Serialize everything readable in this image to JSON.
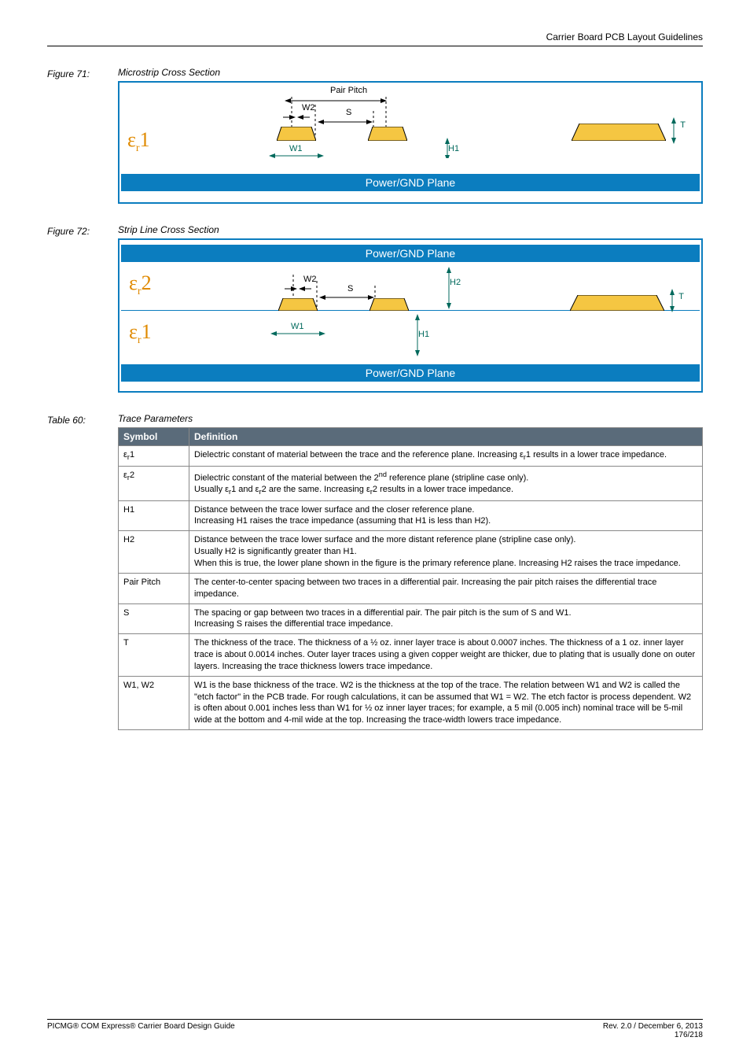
{
  "header": {
    "title": "Carrier Board PCB Layout Guidelines"
  },
  "figure71": {
    "label": "Figure 71:",
    "title": "Microstrip Cross Section",
    "pair_pitch": "Pair Pitch",
    "w2": "W2",
    "s": "S",
    "w1": "W1",
    "t": "T",
    "h1": "H1",
    "eps1": "ε",
    "eps1_sub": "r",
    "eps1_num": "1",
    "plane": "Power/GND Plane"
  },
  "figure72": {
    "label": "Figure 72:",
    "title": "Strip Line Cross Section",
    "plane_top": "Power/GND Plane",
    "plane_bot": "Power/GND Plane",
    "eps2": "ε",
    "eps2_sub": "r",
    "eps2_num": "2",
    "eps1": "ε",
    "eps1_sub": "r",
    "eps1_num": "1",
    "w2": "W2",
    "s": "S",
    "h2": "H2",
    "w1": "W1",
    "h1": "H1",
    "t": "T"
  },
  "table60": {
    "label": "Table 60:",
    "title": "Trace Parameters",
    "headers": {
      "symbol": "Symbol",
      "definition": "Definition"
    },
    "rows": [
      {
        "sym": "εr1",
        "def": "Dielectric constant of material between the trace and the reference plane.  Increasing εr1 results in a lower trace impedance."
      },
      {
        "sym": "εr2",
        "def": "Dielectric constant of the material between the 2nd reference plane (stripline case only).\nUsually εr1 and εr2 are the same.  Increasing εr2 results in a lower trace impedance."
      },
      {
        "sym": "H1",
        "def": "Distance between the trace lower surface and the closer reference plane.\nIncreasing H1 raises the trace impedance (assuming that H1 is less than H2)."
      },
      {
        "sym": "H2",
        "def": "Distance between the trace lower surface and the more distant reference plane (stripline case only).\nUsually H2 is significantly greater than H1.\nWhen this is true, the lower plane shown in the figure is the primary reference plane.  Increasing H2 raises the trace impedance."
      },
      {
        "sym": "Pair Pitch",
        "def": "The center-to-center spacing between two traces in a differential pair.  Increasing the pair pitch raises the differential trace impedance."
      },
      {
        "sym": "S",
        "def": "The spacing or gap between two traces in a differential pair.  The pair pitch is the sum of S and W1.\nIncreasing S raises the differential trace impedance."
      },
      {
        "sym": "T",
        "def": "The thickness of the trace.  The thickness of a ½ oz.  inner layer trace is about 0.0007 inches.  The thickness of a 1 oz.  inner layer trace is about 0.0014 inches.  Outer layer traces using a given copper weight are thicker, due to plating that is usually done on outer layers.  Increasing the trace thickness lowers trace impedance."
      },
      {
        "sym": "W1, W2",
        "def": "W1 is the base thickness of the trace.  W2 is the thickness at the top of the trace.  The relation between W1 and W2 is called the \"etch factor\" in the PCB trade.  For rough calculations, it can be assumed that W1 = W2.  The etch factor is process dependent.  W2 is often about 0.001 inches less than W1 for ½ oz inner layer traces; for example, a 5 mil (0.005 inch) nominal trace will be 5-mil wide at the bottom and 4-mil wide at the top.  Increasing the trace-width lowers trace impedance."
      }
    ]
  },
  "footer": {
    "left": "PICMG® COM Express® Carrier Board Design Guide",
    "right_top": "Rev. 2.0 / December 6, 2013",
    "right_bot": "176/218"
  }
}
